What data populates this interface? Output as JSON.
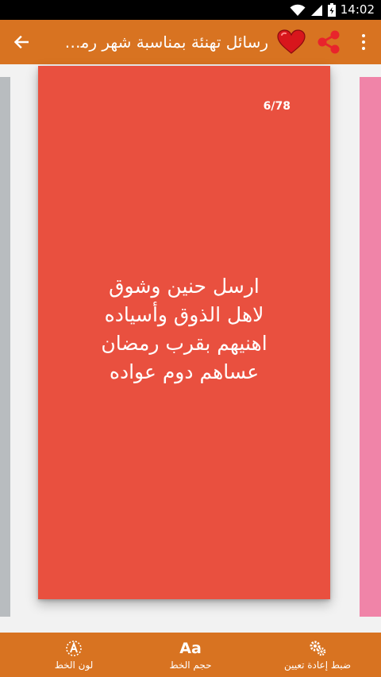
{
  "status_bar": {
    "time": "14:02"
  },
  "toolbar": {
    "title": "رسائل تهنئة بمناسبة شهر رمضا..."
  },
  "card": {
    "counter": "6/78",
    "lines": [
      "ارسل حنين وشوق",
      "لاهل الذوق وأسياده",
      "اهنيهم بقرب رمضان",
      "عساهم دوم عواده"
    ]
  },
  "bottom_bar": {
    "font_color_label": "لون الخط",
    "font_size_label": "حجم الخط",
    "font_size_icon_text": "Aa",
    "reset_label": "ضبط إعادة تعيين"
  },
  "colors": {
    "toolbar": "#d87321",
    "card_main": "#e9503f",
    "card_left": "#b8bcbf",
    "card_right": "#f084a8",
    "heart": "#d8161c",
    "share": "#e8242c"
  }
}
